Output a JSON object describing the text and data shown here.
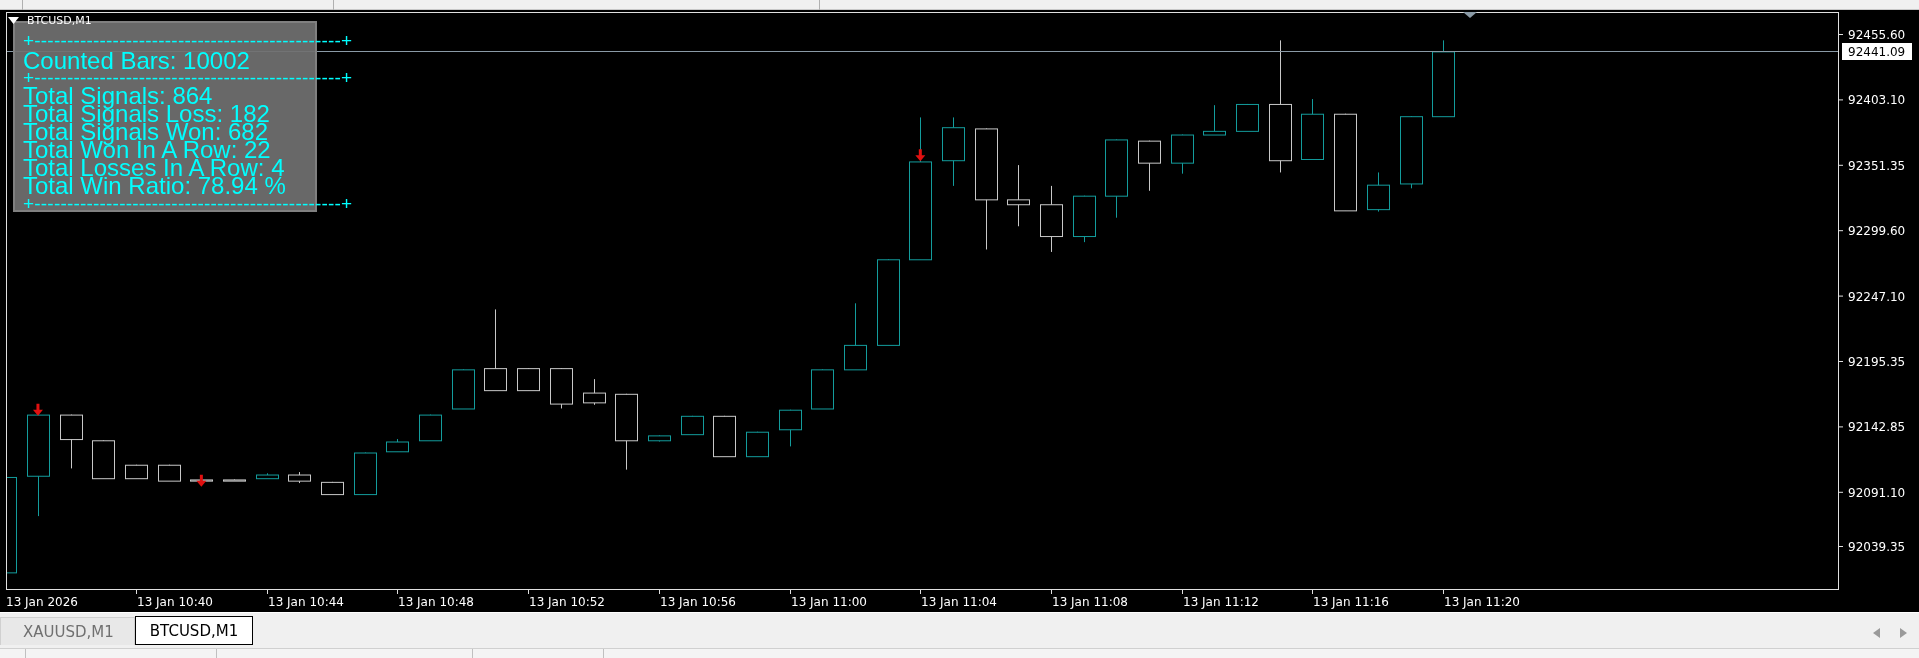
{
  "chart": {
    "symbol": "BTCUSD,M1",
    "stats_panel": {
      "lines": [
        {
          "kind": "rule",
          "text": "+-----------------------------------------------+"
        },
        {
          "kind": "heading",
          "text": "Counted Bars: 10002"
        },
        {
          "kind": "rule",
          "text": "+-----------------------------------------------+"
        },
        {
          "kind": "stat",
          "text": "Total Signals: 864"
        },
        {
          "kind": "stat",
          "text": "Total Signals Loss: 182"
        },
        {
          "kind": "stat",
          "text": "Total Signals Won: 682"
        },
        {
          "kind": "stat",
          "text": "Total Won In A Row: 22"
        },
        {
          "kind": "stat",
          "text": "Total Losses In A Row: 4"
        },
        {
          "kind": "stat",
          "text": "Total Win Ratio: 78.94 %"
        },
        {
          "kind": "rule",
          "text": "+-----------------------------------------------+"
        }
      ]
    },
    "price_axis": {
      "labels": [
        "92455.60",
        "92403.10",
        "92351.35",
        "92299.60",
        "92247.10",
        "92195.35",
        "92142.85",
        "92091.10",
        "92039.35"
      ],
      "current_price": "92441.09"
    },
    "time_axis": {
      "labels": [
        "13 Jan 2026",
        "13 Jan 10:40",
        "13 Jan 10:44",
        "13 Jan 10:48",
        "13 Jan 10:52",
        "13 Jan 10:56",
        "13 Jan 11:00",
        "13 Jan 11:04",
        "13 Jan 11:08",
        "13 Jan 11:12",
        "13 Jan 11:16",
        "13 Jan 11:20"
      ]
    }
  },
  "tabs": [
    {
      "label": "XAUUSD,M1",
      "selected": false
    },
    {
      "label": "BTCUSD,M1",
      "selected": true
    }
  ]
}
